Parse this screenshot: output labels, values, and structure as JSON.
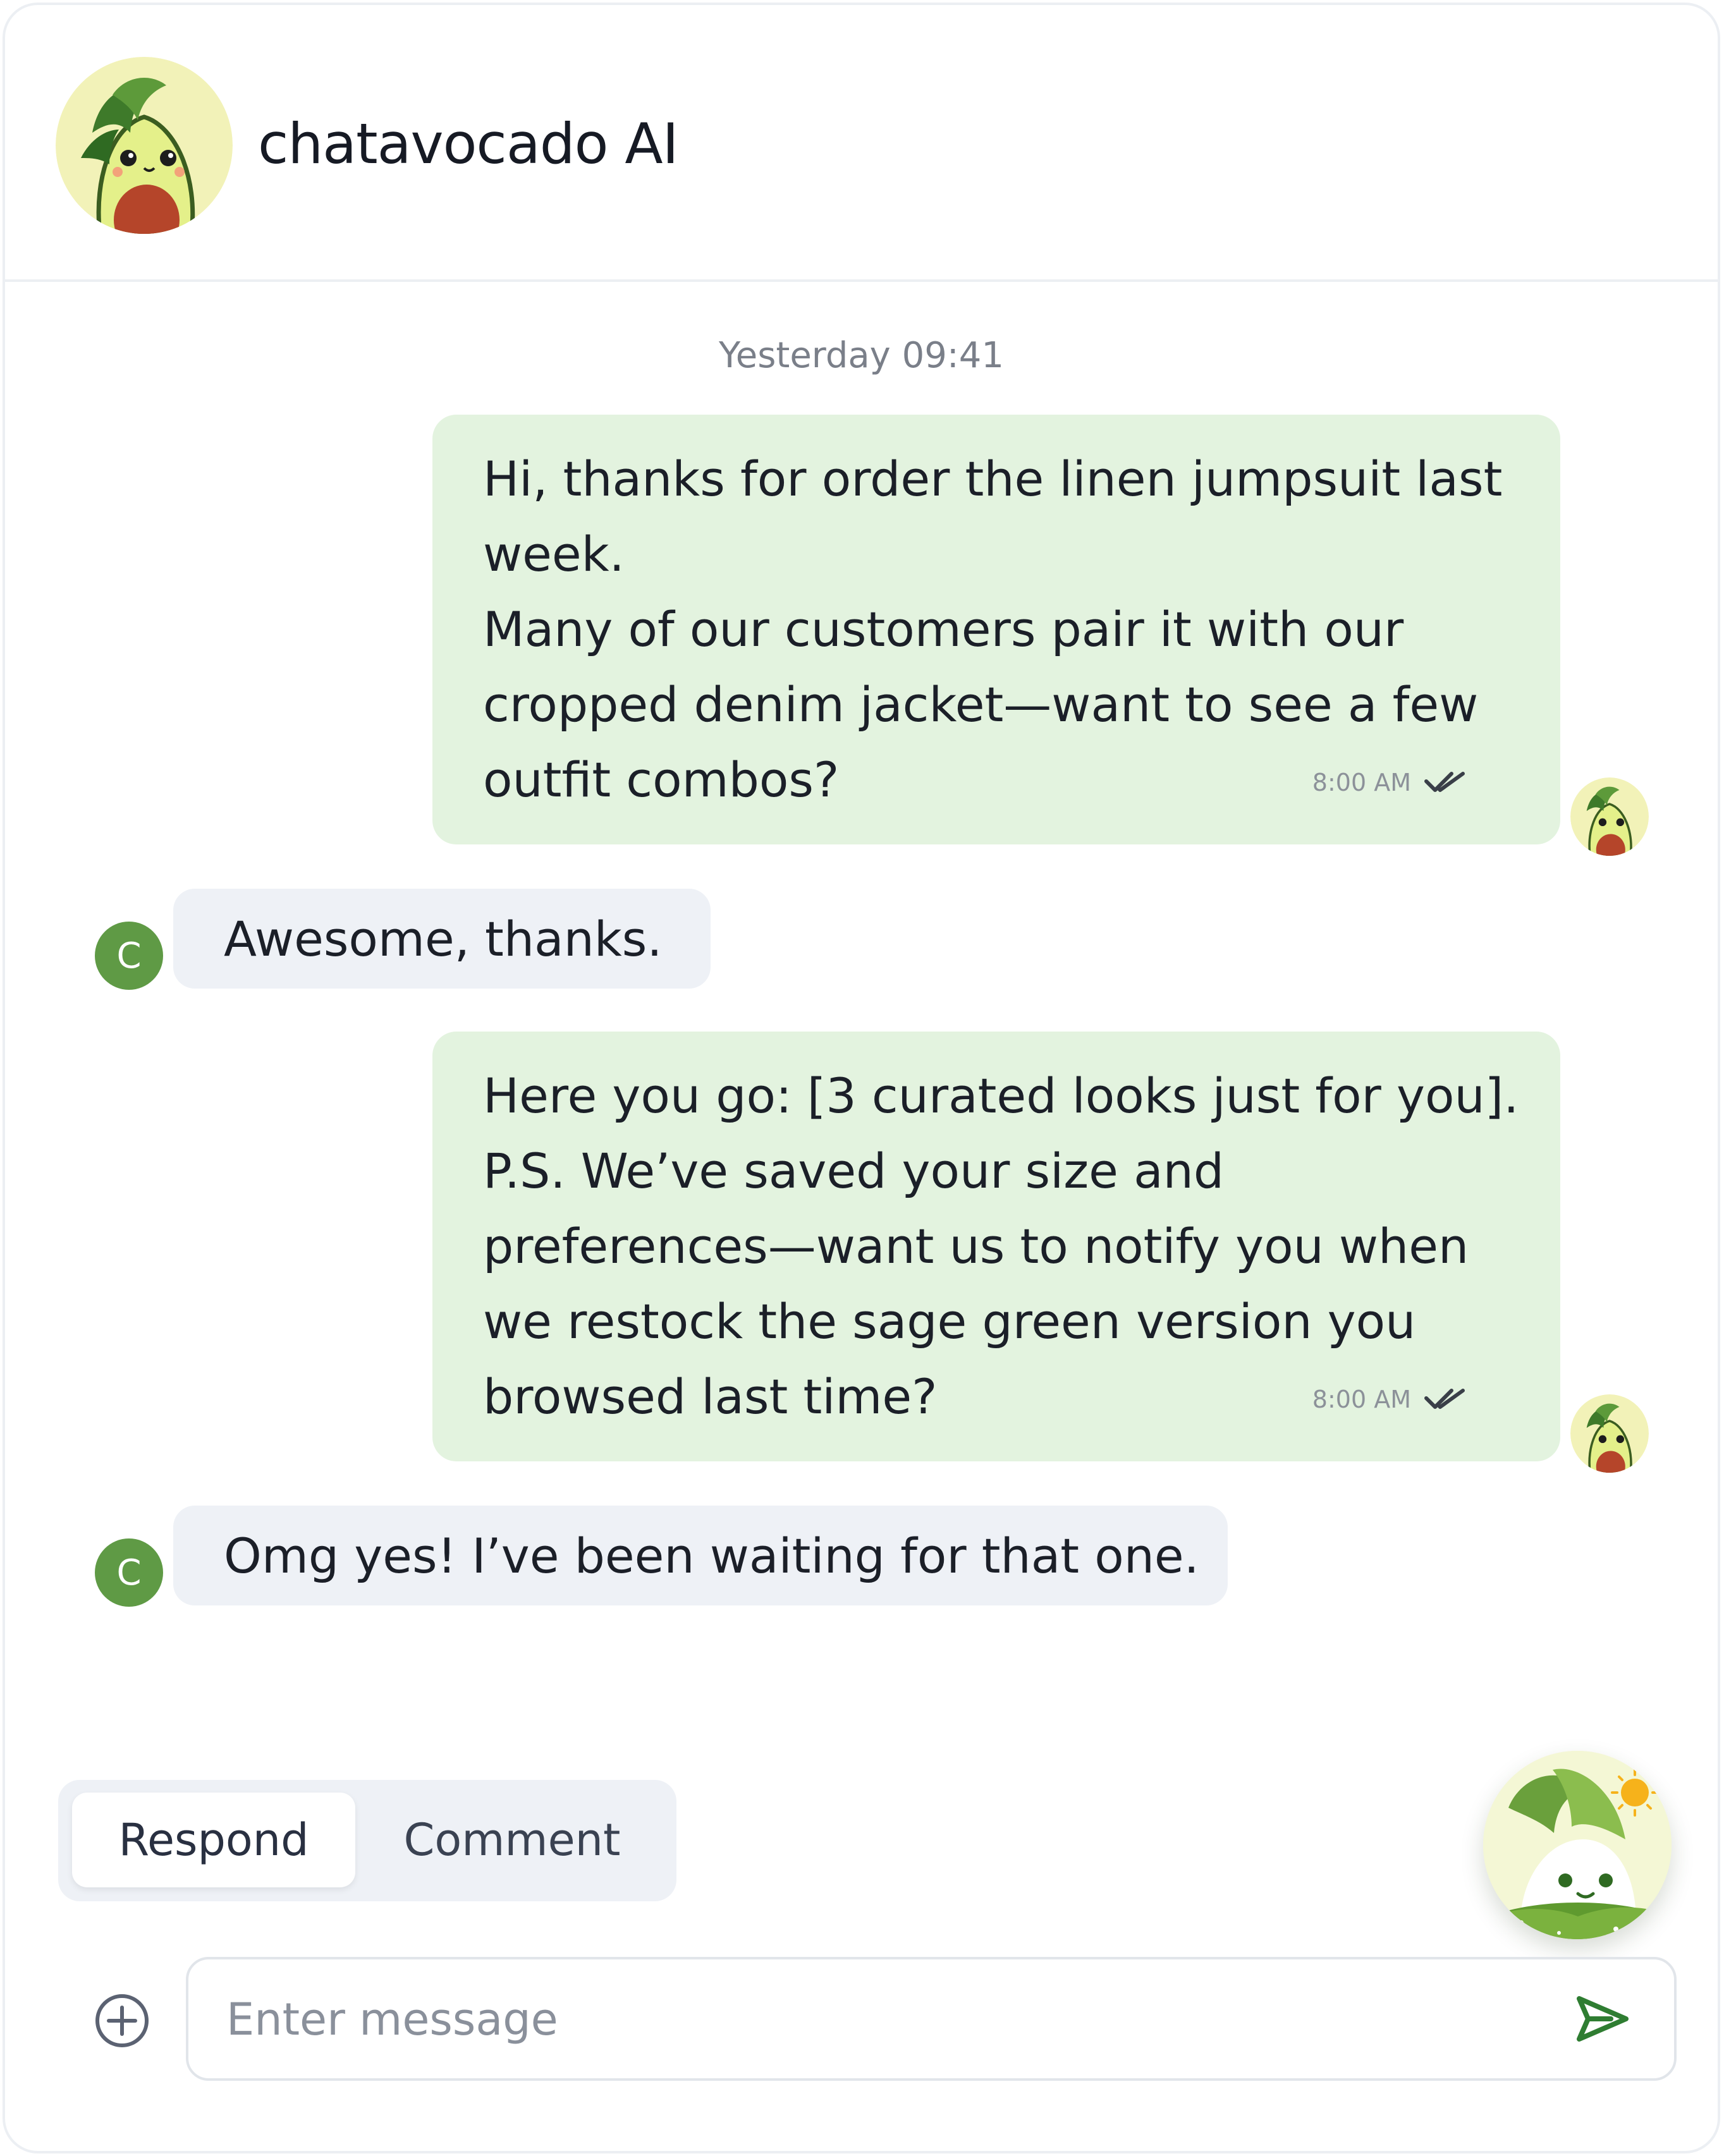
{
  "app": {
    "title": "chatavocado AI"
  },
  "conversation": {
    "timestamp": "Yesterday 09:41",
    "messages": [
      {
        "role": "ai",
        "lines": [
          "Hi, thanks for order the linen jumpsuit last",
          "week.",
          "Many of our customers pair it with our",
          "cropped denim jacket—want to see a few",
          "outfit combos?"
        ],
        "time": "8:00 AM",
        "status_icon": "double-check-icon"
      },
      {
        "role": "user",
        "avatar_letter": "C",
        "text": "Awesome, thanks."
      },
      {
        "role": "ai",
        "lines": [
          "Here you go: [3 curated looks just for you].",
          "P.S. We’ve saved your size and",
          "preferences—want us to notify you when",
          "we restock the sage green version you",
          "browsed last time?"
        ],
        "time": "8:00 AM",
        "status_icon": "double-check-icon"
      },
      {
        "role": "user",
        "avatar_letter": "C",
        "text": "Omg yes! I’ve been waiting for that one."
      }
    ]
  },
  "mode_toggle": {
    "respond_label": "Respond",
    "comment_label": "Comment",
    "selected": "Respond"
  },
  "composer": {
    "placeholder": "Enter message",
    "value": "",
    "add_icon": "plus-circle-icon",
    "send_icon": "send-icon"
  },
  "colors": {
    "ai_bubble": "#e3f3df",
    "user_bubble": "#eef1f6",
    "user_avatar": "#5f9a45",
    "accent_green": "#2f7d32",
    "border": "#eceff3"
  }
}
